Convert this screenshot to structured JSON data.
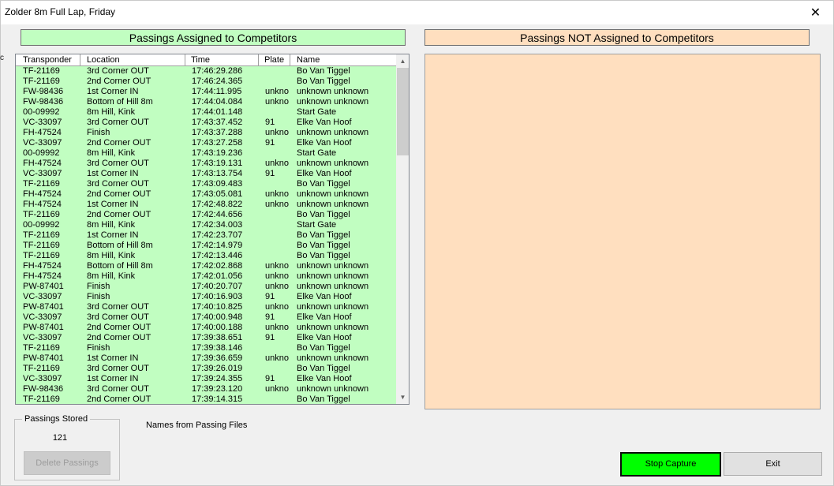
{
  "window": {
    "title": "Zolder 8m Full Lap, Friday",
    "close_glyph": "✕"
  },
  "edge_mark": "c",
  "headers": {
    "assigned": "Passings Assigned to Competitors",
    "unassigned": "Passings NOT Assigned to Competitors"
  },
  "table": {
    "columns": [
      "Transponder",
      "Location",
      "Time",
      "Plate",
      "Name"
    ],
    "rows": [
      [
        "TF-21169",
        "3rd Corner OUT",
        "17:46:29.286",
        "",
        "Bo Van Tiggel"
      ],
      [
        "TF-21169",
        "2nd Corner OUT",
        "17:46:24.365",
        "",
        "Bo Van Tiggel"
      ],
      [
        "FW-98436",
        "1st Corner IN",
        "17:44:11.995",
        "unkno",
        "unknown unknown"
      ],
      [
        "FW-98436",
        "Bottom of Hill 8m",
        "17:44:04.084",
        "unkno",
        "unknown unknown"
      ],
      [
        "00-09992",
        "8m Hill, Kink",
        "17:44:01.148",
        "",
        "Start Gate"
      ],
      [
        "VC-33097",
        "3rd Corner OUT",
        "17:43:37.452",
        "91",
        "Elke Van Hoof"
      ],
      [
        "FH-47524",
        "Finish",
        "17:43:37.288",
        "unkno",
        "unknown unknown"
      ],
      [
        "VC-33097",
        "2nd Corner OUT",
        "17:43:27.258",
        "91",
        "Elke Van Hoof"
      ],
      [
        "00-09992",
        "8m Hill, Kink",
        "17:43:19.236",
        "",
        "Start Gate"
      ],
      [
        "FH-47524",
        "3rd Corner OUT",
        "17:43:19.131",
        "unkno",
        "unknown unknown"
      ],
      [
        "VC-33097",
        "1st Corner IN",
        "17:43:13.754",
        "91",
        "Elke Van Hoof"
      ],
      [
        "TF-21169",
        "3rd Corner OUT",
        "17:43:09.483",
        "",
        "Bo Van Tiggel"
      ],
      [
        "FH-47524",
        "2nd Corner OUT",
        "17:43:05.081",
        "unkno",
        "unknown unknown"
      ],
      [
        "FH-47524",
        "1st Corner IN",
        "17:42:48.822",
        "unkno",
        "unknown unknown"
      ],
      [
        "TF-21169",
        "2nd Corner OUT",
        "17:42:44.656",
        "",
        "Bo Van Tiggel"
      ],
      [
        "00-09992",
        "8m Hill, Kink",
        "17:42:34.003",
        "",
        "Start Gate"
      ],
      [
        "TF-21169",
        "1st Corner IN",
        "17:42:23.707",
        "",
        "Bo Van Tiggel"
      ],
      [
        "TF-21169",
        "Bottom of Hill 8m",
        "17:42:14.979",
        "",
        "Bo Van Tiggel"
      ],
      [
        "TF-21169",
        "8m Hill, Kink",
        "17:42:13.446",
        "",
        "Bo Van Tiggel"
      ],
      [
        "FH-47524",
        "Bottom of Hill 8m",
        "17:42:02.868",
        "unkno",
        "unknown unknown"
      ],
      [
        "FH-47524",
        "8m Hill, Kink",
        "17:42:01.056",
        "unkno",
        "unknown unknown"
      ],
      [
        "PW-87401",
        "Finish",
        "17:40:20.707",
        "unkno",
        "unknown unknown"
      ],
      [
        "VC-33097",
        "Finish",
        "17:40:16.903",
        "91",
        "Elke Van Hoof"
      ],
      [
        "PW-87401",
        "3rd Corner OUT",
        "17:40:10.825",
        "unkno",
        "unknown unknown"
      ],
      [
        "VC-33097",
        "3rd Corner OUT",
        "17:40:00.948",
        "91",
        "Elke Van Hoof"
      ],
      [
        "PW-87401",
        "2nd Corner OUT",
        "17:40:00.188",
        "unkno",
        "unknown unknown"
      ],
      [
        "VC-33097",
        "2nd Corner OUT",
        "17:39:38.651",
        "91",
        "Elke Van Hoof"
      ],
      [
        "TF-21169",
        "Finish",
        "17:39:38.146",
        "",
        "Bo Van Tiggel"
      ],
      [
        "PW-87401",
        "1st Corner IN",
        "17:39:36.659",
        "unkno",
        "unknown unknown"
      ],
      [
        "TF-21169",
        "3rd Corner OUT",
        "17:39:26.019",
        "",
        "Bo Van Tiggel"
      ],
      [
        "VC-33097",
        "1st Corner IN",
        "17:39:24.355",
        "91",
        "Elke Van Hoof"
      ],
      [
        "FW-98436",
        "3rd Corner OUT",
        "17:39:23.120",
        "unkno",
        "unknown unknown"
      ],
      [
        "TF-21169",
        "2nd Corner OUT",
        "17:39:14.315",
        "",
        "Bo Van Tiggel"
      ]
    ]
  },
  "scrollbar": {
    "up_glyph": "▲",
    "down_glyph": "▼"
  },
  "passings_stored": {
    "legend": "Passings Stored",
    "count": "121",
    "delete_label": "Delete Passings"
  },
  "names_source": "Names from Passing Files",
  "buttons": {
    "stop_capture": "Stop Capture",
    "exit": "Exit"
  },
  "colors": {
    "assigned_bg": "#c1fec1",
    "unassigned_bg": "#ffdfbf",
    "stop_capture_bg": "#00ff00"
  }
}
